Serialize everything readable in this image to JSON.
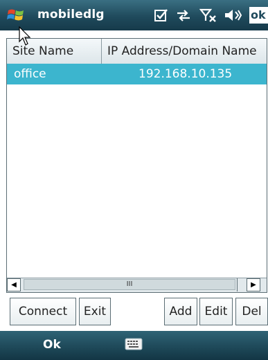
{
  "titlebar": {
    "title": "mobiledlg",
    "ok_label": "ok"
  },
  "list": {
    "columns": [
      "Site Name",
      "IP Address/Domain Name"
    ],
    "rows": [
      {
        "site": "office",
        "ip": "192.168.10.135",
        "selected": true
      }
    ]
  },
  "scrollbar": {
    "thumb_glyph": "III",
    "left_arrow": "◀",
    "right_arrow": "▶"
  },
  "buttons": {
    "connect": "Connect",
    "exit": "Exit",
    "add": "Add",
    "edit": "Edit",
    "del": "Del"
  },
  "softkeys": {
    "left": "Ok"
  },
  "colors": {
    "titlebar": "#1f4a5c",
    "selection": "#3cb5ce"
  },
  "icons": [
    "windows-flag-icon",
    "tasks-icon",
    "connectivity-icon",
    "signal-off-icon",
    "speaker-icon",
    "keyboard-icon"
  ]
}
